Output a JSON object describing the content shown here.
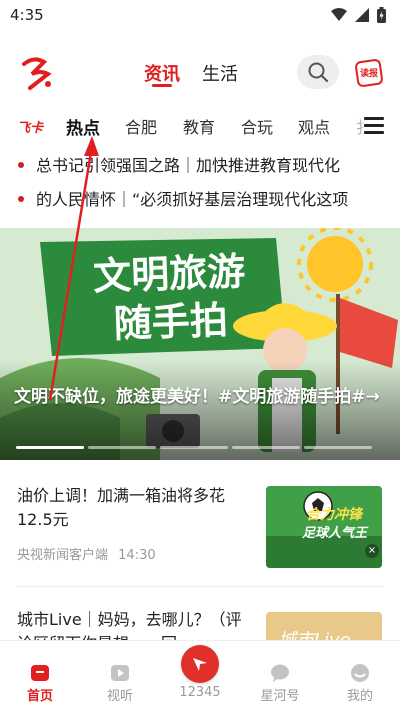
{
  "status_bar": {
    "time": "4:35"
  },
  "header": {
    "main_tabs": [
      {
        "label": "资讯",
        "active": true
      },
      {
        "label": "生活",
        "active": false
      }
    ],
    "news_icon": "读报"
  },
  "channels": {
    "badge": "飞卡",
    "tabs": [
      {
        "label": "热点",
        "active": true
      },
      {
        "label": "合肥"
      },
      {
        "label": "教育"
      },
      {
        "label": "合玩"
      },
      {
        "label": "观点"
      },
      {
        "label": "扌"
      }
    ]
  },
  "headlines": [
    "总书记引领强国之路｜加快推进教育现代化",
    "的人民情怀｜“必须抓好基层治理现代化这项"
  ],
  "banner": {
    "art_title_line1": "文明旅游",
    "art_title_line2": "随手拍",
    "caption": "文明不缺位，旅途更美好！#文明旅游随手拍#→",
    "slide_count": 5,
    "active_slide": 0
  },
  "feed": [
    {
      "title": "油价上调！加满一箱油将多花12.5元",
      "source": "央视新闻客户端",
      "time": "14:30",
      "thumb_text_1": "合力冲锋",
      "thumb_text_2": "足球人气王"
    },
    {
      "title": "城市Live｜妈妈，去哪儿？（评论区留下你最想……回……",
      "thumb_text_1": "城市Live"
    }
  ],
  "bottom_nav": [
    {
      "label": "首页",
      "icon": "home-icon",
      "active": true
    },
    {
      "label": "视听",
      "icon": "play-icon"
    },
    {
      "label": "12345",
      "icon": "hotline-icon"
    },
    {
      "label": "星河号",
      "icon": "chat-icon"
    },
    {
      "label": "我的",
      "icon": "profile-icon"
    }
  ],
  "colors": {
    "accent": "#e02020",
    "text": "#222222",
    "meta": "#999999"
  }
}
